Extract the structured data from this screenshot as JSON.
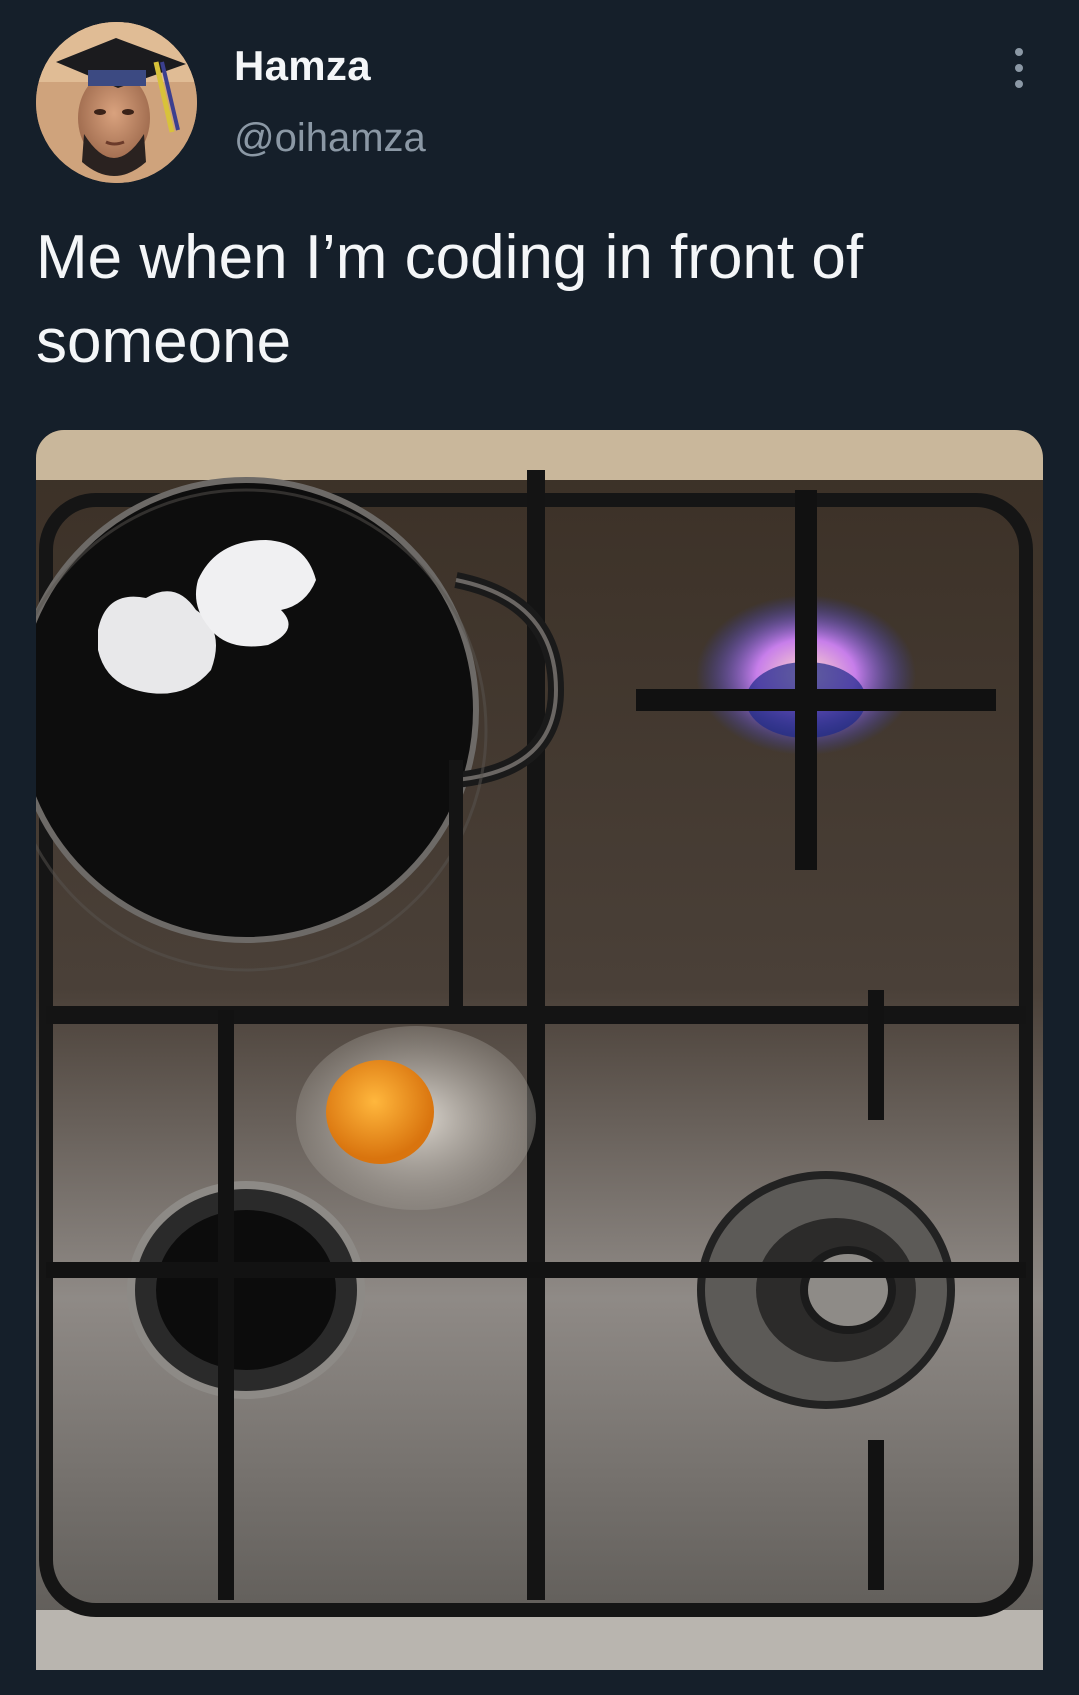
{
  "author": {
    "display_name": "Hamza",
    "handle": "@oihamza"
  },
  "tweet": {
    "text": "Me when I’m coding in front of someone"
  },
  "icons": {
    "more": "more-vertical-icon",
    "avatar": "avatar-image"
  },
  "colors": {
    "background": "#151f2a",
    "primary_text": "#f4f6f8",
    "secondary_text": "#8b98a5"
  }
}
